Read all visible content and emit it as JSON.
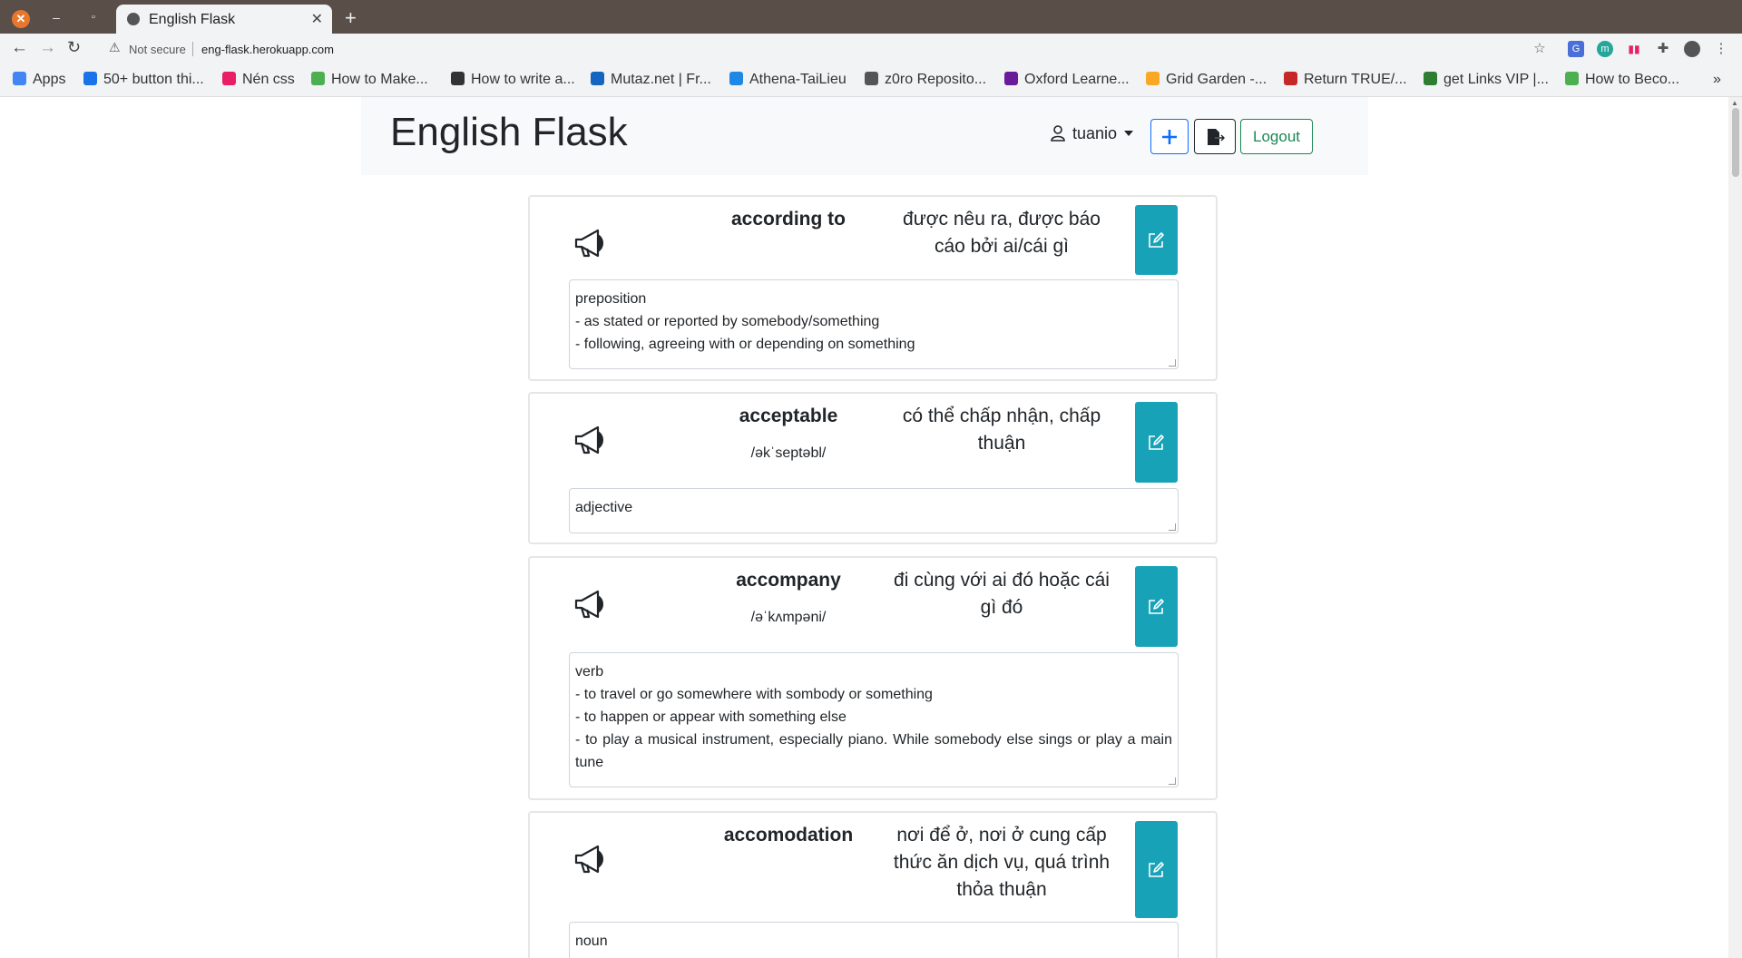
{
  "browser": {
    "tab_title": "English Flask",
    "security_label": "Not secure",
    "url": "eng-flask.herokuapp.com",
    "bookmarks": [
      {
        "label": "Apps",
        "color": "#4285f4"
      },
      {
        "label": "50+ button thi...",
        "color": "#1a73e8"
      },
      {
        "label": "Nén css",
        "color": "#e91e63"
      },
      {
        "label": "How to Make...",
        "color": "#4caf50"
      },
      {
        "label": "How to write a...",
        "color": "#333333"
      },
      {
        "label": "Mutaz.net | Fr...",
        "color": "#1565c0"
      },
      {
        "label": "Athena-TaiLieu",
        "color": "#1e88e5"
      },
      {
        "label": "z0ro Reposito...",
        "color": "#555555"
      },
      {
        "label": "Oxford Learne...",
        "color": "#6a1b9a"
      },
      {
        "label": "Grid Garden -...",
        "color": "#f9a825"
      },
      {
        "label": "Return TRUE/...",
        "color": "#c62828"
      },
      {
        "label": "get Links VIP |...",
        "color": "#2e7d32"
      },
      {
        "label": "How to Beco...",
        "color": "#4caf50"
      }
    ]
  },
  "header": {
    "brand": "English Flask",
    "username": "tuanio",
    "add_icon": "plus-icon",
    "export_icon": "export-file-icon",
    "logout_label": "Logout"
  },
  "cards": [
    {
      "word": "according to",
      "phonetic": "",
      "meaning": "được nêu ra, được báo cáo bởi ai/cái gì",
      "definition": [
        "preposition",
        "- as stated or reported by somebody/something",
        "- following, agreeing with or depending on something"
      ]
    },
    {
      "word": "acceptable",
      "phonetic": "/əkˈseptəbl/",
      "meaning": "có thể chấp nhận, chấp thuận",
      "definition": [
        "adjective"
      ]
    },
    {
      "word": "accompany",
      "phonetic": "/əˈkʌmpəni/",
      "meaning": "đi cùng với ai đó hoặc cái gì đó",
      "definition": [
        "verb",
        "- to travel or go somewhere with sombody or something",
        "- to happen or appear with something else",
        "- to play a musical instrument, especially piano. While somebody else sings or play a main tune"
      ]
    },
    {
      "word": "accomodation",
      "phonetic": "",
      "meaning": "nơi để ở, nơi ở cung cấp thức ăn dịch vụ, quá trình thỏa thuận",
      "definition": [
        "noun"
      ]
    }
  ],
  "colors": {
    "accent_teal": "#17a2b8",
    "add_blue": "#0d6efd",
    "logout_green": "#198754"
  }
}
